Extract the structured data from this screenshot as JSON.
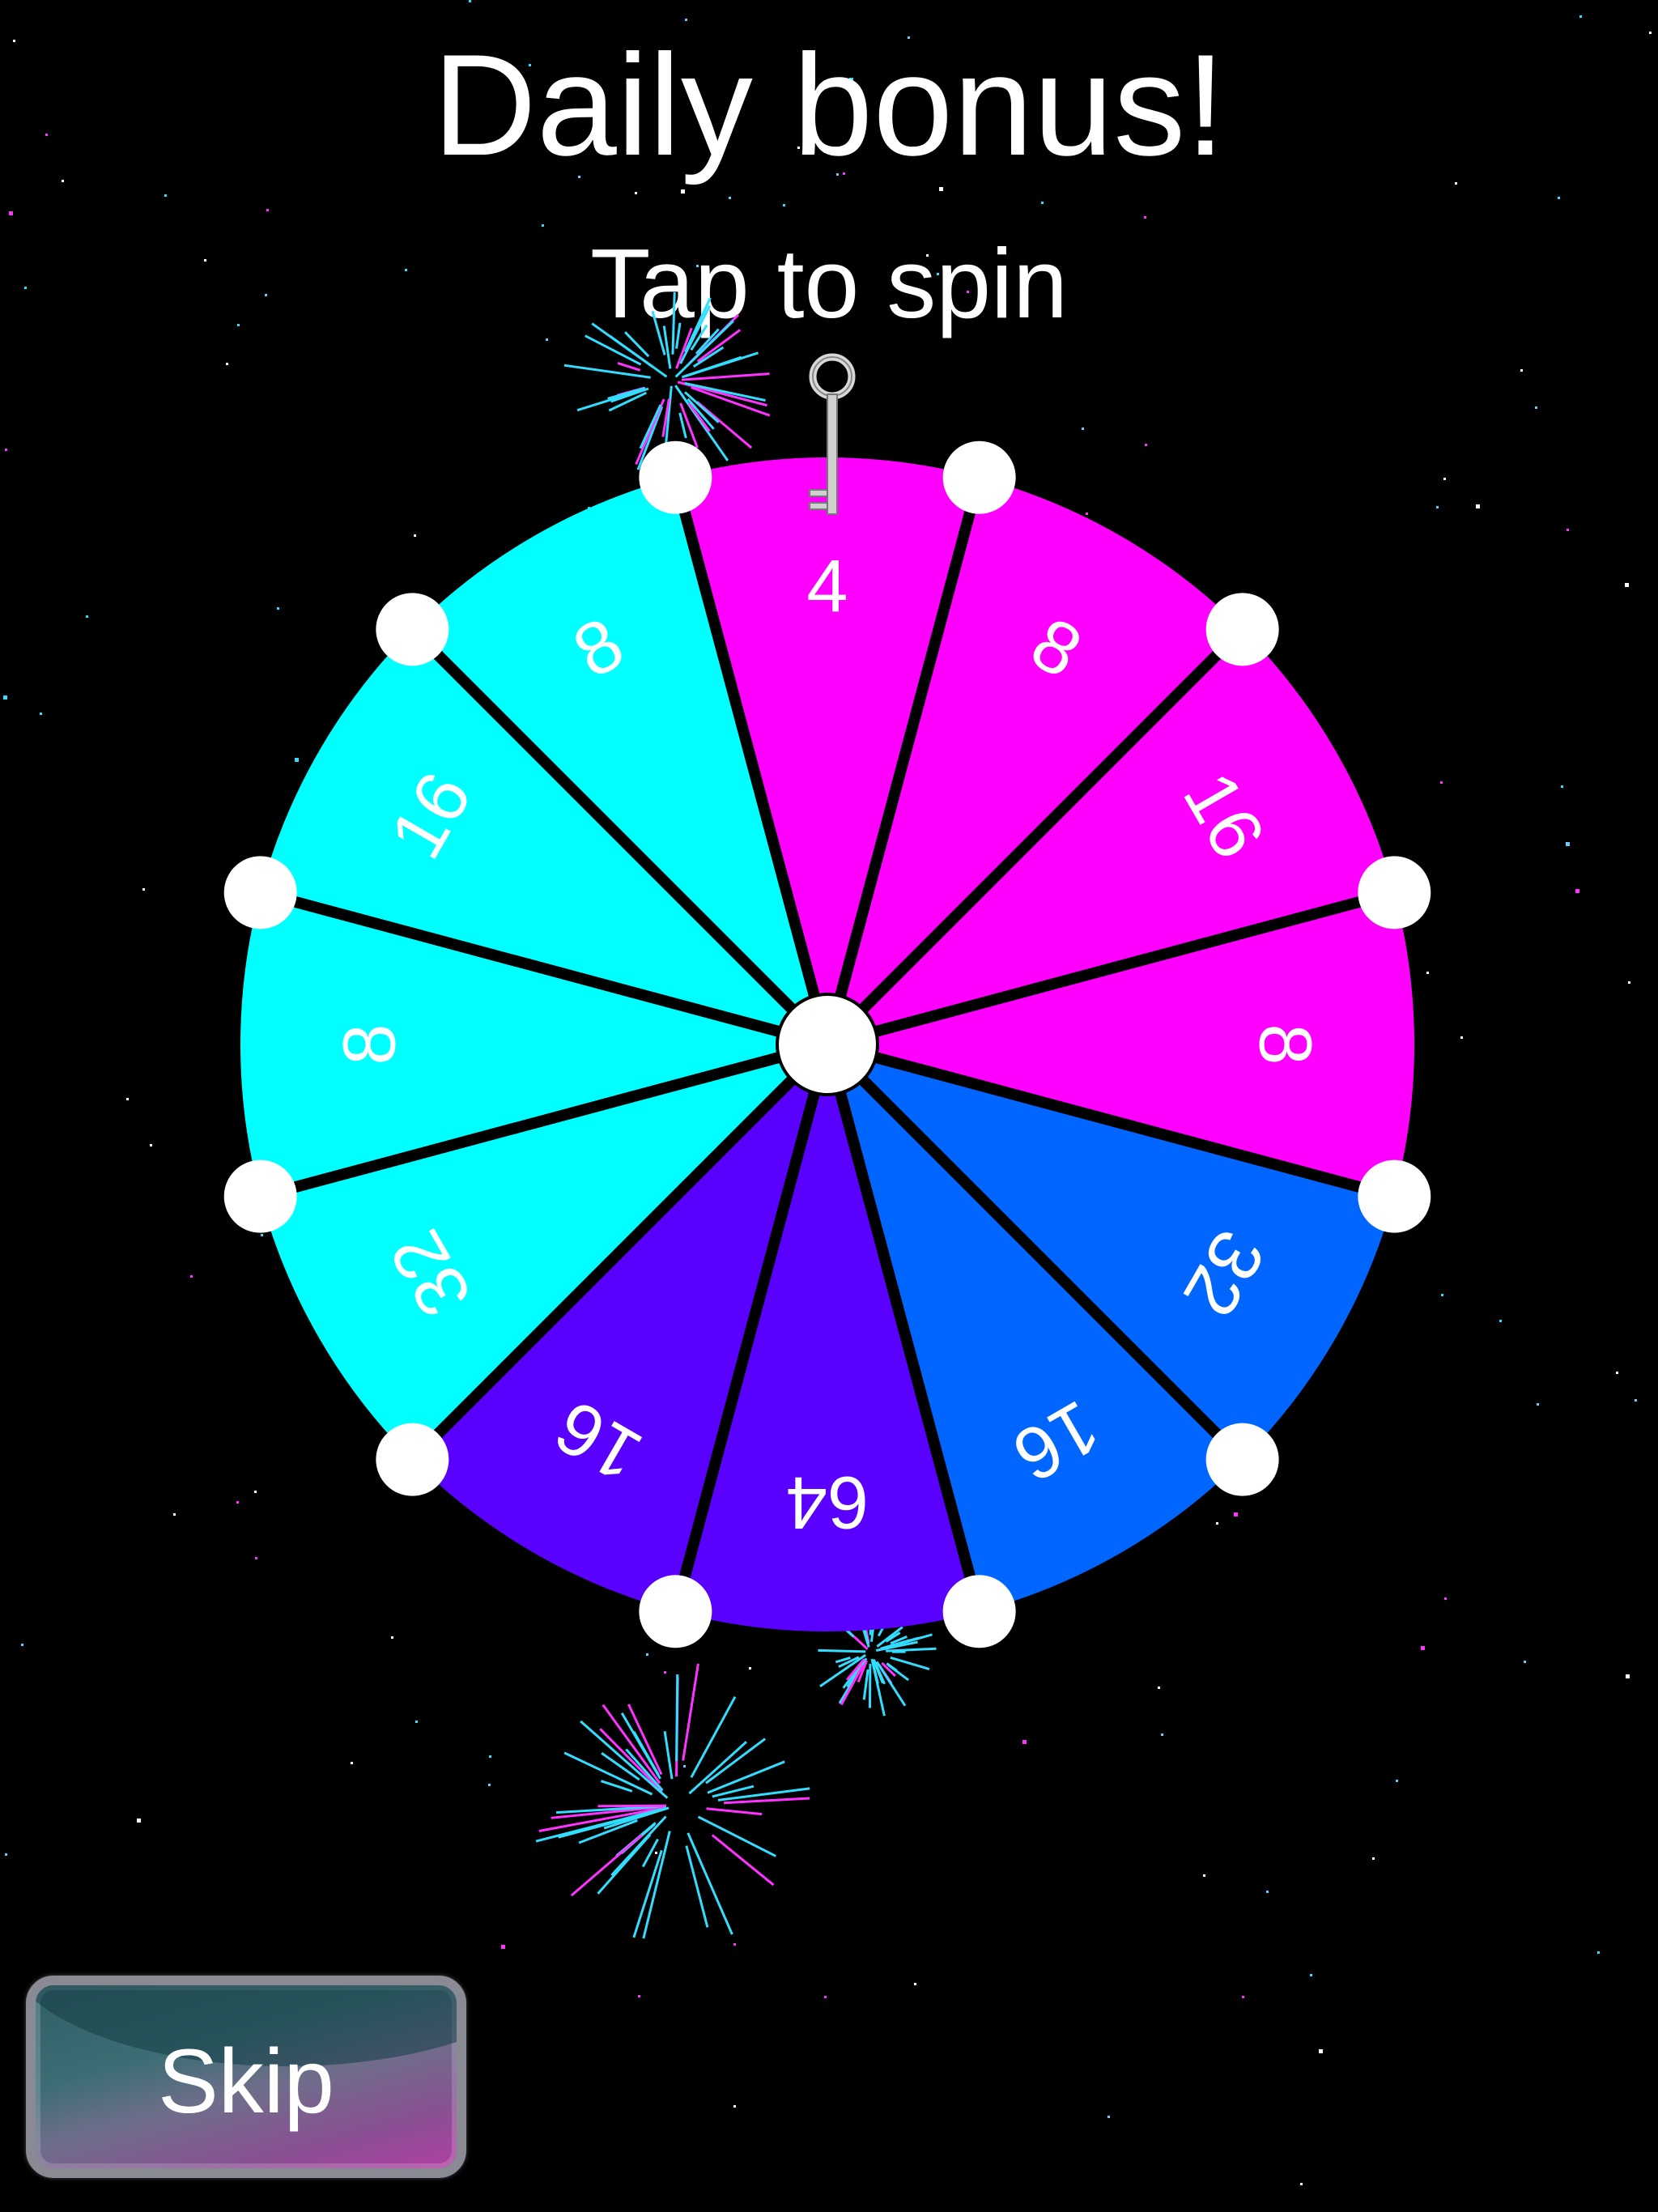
{
  "header": {
    "title": "Daily bonus!",
    "subtitle": "Tap to spin"
  },
  "wheel": {
    "segments": [
      {
        "label": "4",
        "color": "#ff00ff"
      },
      {
        "label": "8",
        "color": "#ff00ff"
      },
      {
        "label": "16",
        "color": "#ff00ff"
      },
      {
        "label": "8",
        "color": "#ff00ff"
      },
      {
        "label": "32",
        "color": "#0066ff"
      },
      {
        "label": "16",
        "color": "#0066ff"
      },
      {
        "label": "64",
        "color": "#5a00ff"
      },
      {
        "label": "16",
        "color": "#5a00ff"
      },
      {
        "label": "32",
        "color": "#00ffff"
      },
      {
        "label": "8",
        "color": "#00ffff"
      },
      {
        "label": "16",
        "color": "#00ffff"
      },
      {
        "label": "8",
        "color": "#00ffff"
      }
    ],
    "pointer_icon": "key-icon",
    "divider_color": "#000000",
    "peg_color": "#ffffff",
    "hub_color": "#ffffff"
  },
  "skip_button": {
    "label": "Skip"
  },
  "colors": {
    "background": "#000000",
    "text": "#ffffff",
    "firework_cyan": "#33ddff",
    "firework_magenta": "#ff33ff"
  }
}
